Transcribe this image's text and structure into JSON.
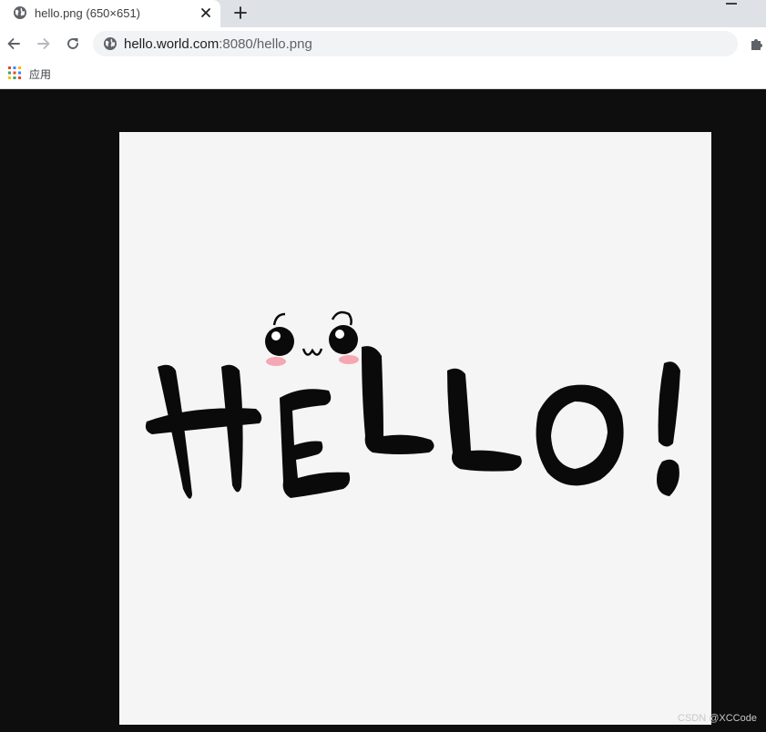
{
  "tab": {
    "title": "hello.png (650×651)"
  },
  "toolbar": {
    "url_host": "hello.world.com",
    "url_rest": ":8080/hello.png"
  },
  "bookmarks": {
    "apps_label": "应用"
  },
  "image": {
    "text": "HELLO!",
    "face": "ω"
  },
  "watermark": "CSDN @XCCode"
}
